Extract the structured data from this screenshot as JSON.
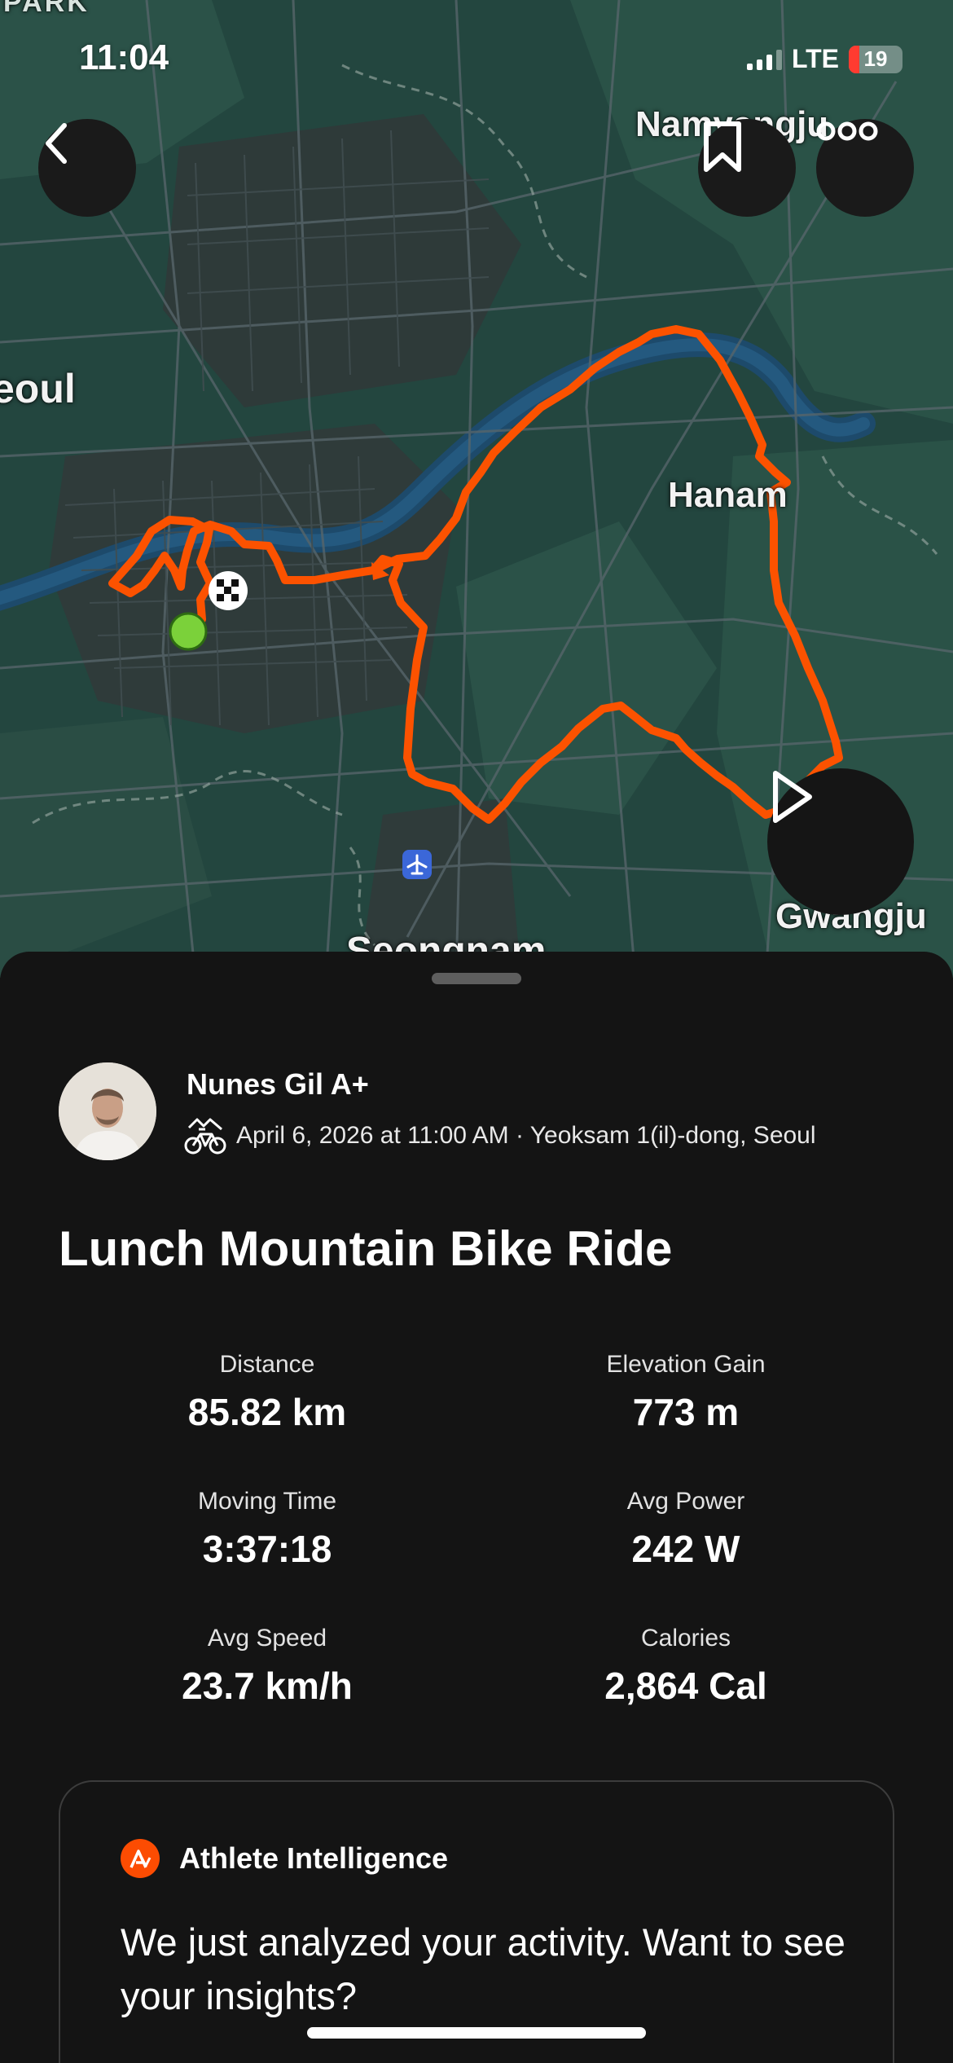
{
  "status_bar": {
    "time": "11:04",
    "network": "LTE",
    "battery": "19"
  },
  "map": {
    "labels": {
      "park": "PARK",
      "seoul": "eoul",
      "namyangju": "Namyangju",
      "hanam": "Hanam",
      "gwangju": "Gwangju",
      "seongnam": "Seongnam"
    },
    "route_color": "#fc5200",
    "start_marker_color": "#7bd13a"
  },
  "toolbar": {
    "back_icon": "chevron-left-icon",
    "bookmark_icon": "bookmark-icon",
    "more_icon": "more-dots-icon",
    "play_icon": "play-icon"
  },
  "activity": {
    "athlete_name": "Nunes Gil A+",
    "sport_icon": "mountain-bike-icon",
    "date_location": "April 6, 2026 at 11:00 AM · Yeoksam 1(il)-dong, Seoul",
    "title": "Lunch Mountain Bike Ride"
  },
  "stats": [
    {
      "label": "Distance",
      "value": "85.82 km"
    },
    {
      "label": "Elevation Gain",
      "value": "773 m"
    },
    {
      "label": "Moving Time",
      "value": "3:37:18"
    },
    {
      "label": "Avg Power",
      "value": "242 W"
    },
    {
      "label": "Avg Speed",
      "value": "23.7 km/h"
    },
    {
      "label": "Calories",
      "value": "2,864 Cal"
    }
  ],
  "athlete_intelligence": {
    "title": "Athlete Intelligence",
    "message": "We just analyzed your activity. Want to see your insights?",
    "accent_color": "#fc4c02"
  }
}
